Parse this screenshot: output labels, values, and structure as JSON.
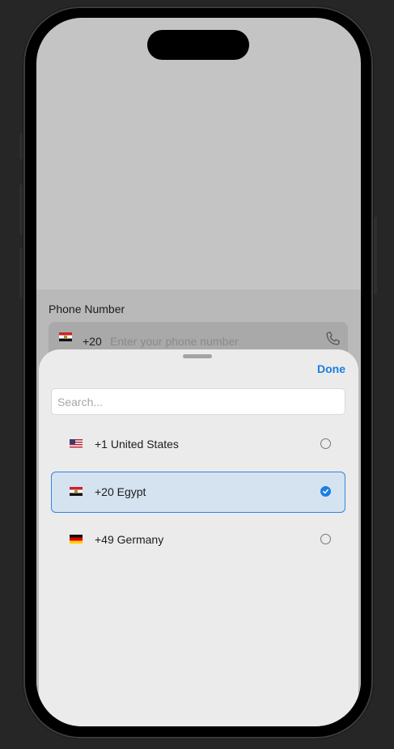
{
  "form": {
    "phone_label": "Phone Number",
    "selected_code": "+20",
    "phone_placeholder": "Enter your phone number"
  },
  "sheet": {
    "done_label": "Done",
    "search_placeholder": "Search...",
    "countries": [
      {
        "label": "+1 United States",
        "flag": "us-flag-icon",
        "selected": false
      },
      {
        "label": "+20 Egypt",
        "flag": "egypt-flag-icon",
        "selected": true
      },
      {
        "label": "+49 Germany",
        "flag": "germany-flag-icon",
        "selected": false
      }
    ]
  },
  "colors": {
    "accent": "#1a7fe0",
    "selected_row_bg": "#d5e2f0"
  }
}
